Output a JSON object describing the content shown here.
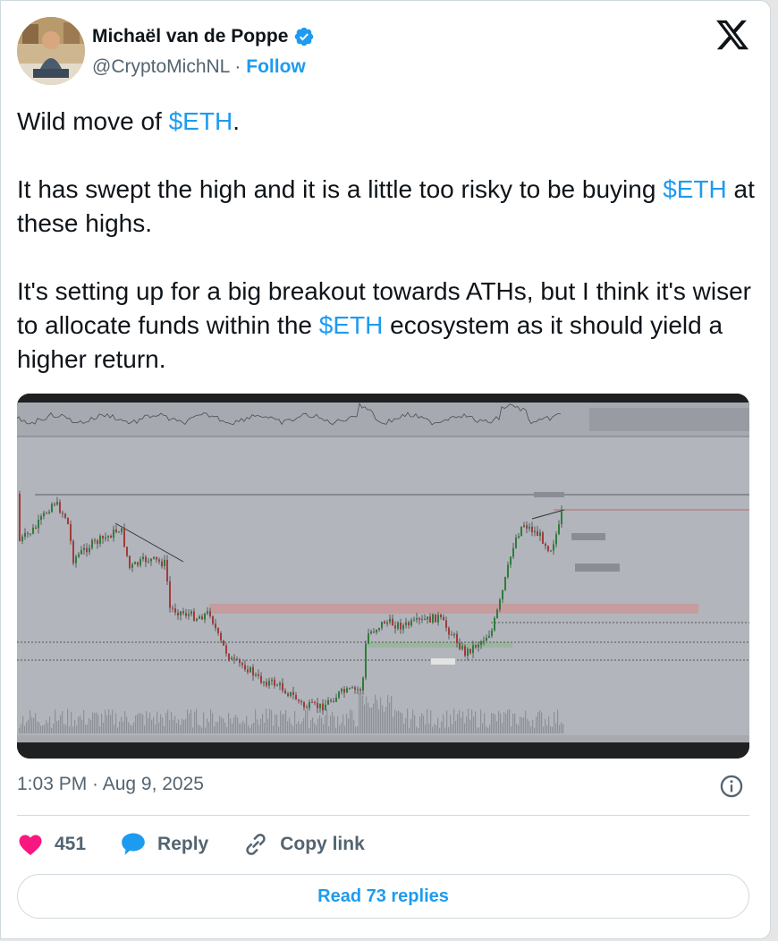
{
  "author": {
    "name": "Michaël van de Poppe",
    "handle": "@CryptoMichNL",
    "separator": "·",
    "follow_label": "Follow"
  },
  "tweet": {
    "paragraphs": [
      [
        {
          "t": "Wild move of "
        },
        {
          "t": "$ETH",
          "tag": true
        },
        {
          "t": "."
        }
      ],
      [
        {
          "t": "It has swept the high and it is a little too risky to be buying "
        },
        {
          "t": "$ETH",
          "tag": true
        },
        {
          "t": " at these highs."
        }
      ],
      [
        {
          "t": "It's setting up for a big breakout towards ATHs, but I think it's wiser to allocate funds within the "
        },
        {
          "t": "$ETH",
          "tag": true
        },
        {
          "t": " ecosystem as it should yield a higher return."
        }
      ]
    ]
  },
  "meta": {
    "timestamp": "1:03 PM · Aug 9, 2025"
  },
  "actions": {
    "like_count": "451",
    "reply_label": "Reply",
    "copy_link_label": "Copy link"
  },
  "footer": {
    "read_replies_label": "Read 73 replies"
  },
  "colors": {
    "accent": "#1d9bf0",
    "like": "#f91880",
    "text": "#0f1419",
    "muted": "#536471",
    "border": "#cfd9de"
  },
  "icons": {
    "verified": "verified-badge-icon",
    "x_logo": "x-logo-icon",
    "info": "info-icon",
    "like": "heart-icon",
    "reply": "speech-bubble-icon",
    "copy_link": "link-icon"
  }
}
